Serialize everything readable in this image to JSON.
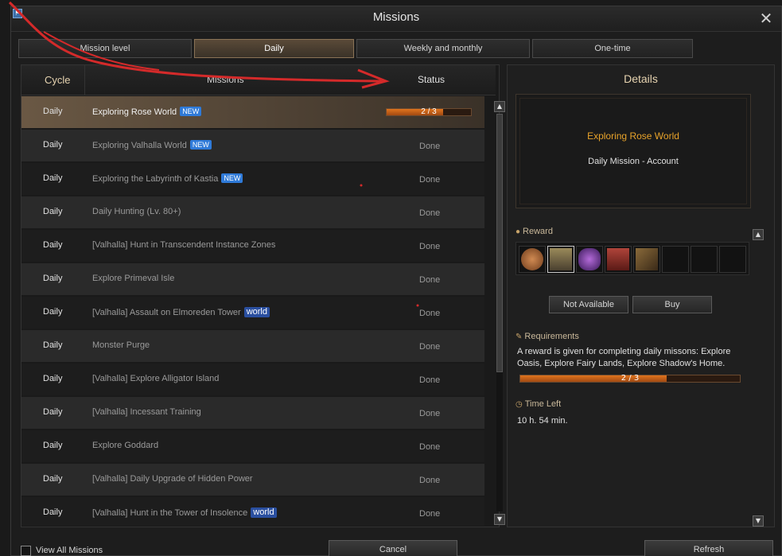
{
  "window": {
    "title": "Missions",
    "close_symbol": "✕",
    "corner_icon": "⚑"
  },
  "tabs": [
    {
      "label": "Mission level",
      "active": false
    },
    {
      "label": "Daily",
      "active": true
    },
    {
      "label": "Weekly and monthly",
      "active": false
    },
    {
      "label": "One-time",
      "active": false
    }
  ],
  "table": {
    "headers": {
      "cycle": "Cycle",
      "missions": "Missions",
      "status": "Status"
    },
    "rows": [
      {
        "cycle": "Daily",
        "name": "Exploring Rose World",
        "badge": "NEW",
        "status": "",
        "progress": "2 / 3"
      },
      {
        "cycle": "Daily",
        "name": "Exploring Valhalla World",
        "badge": "NEW",
        "status": "Done"
      },
      {
        "cycle": "Daily",
        "name": "Exploring the Labyrinth of Kastia",
        "badge": "NEW",
        "status": "Done"
      },
      {
        "cycle": "Daily",
        "name": "Daily Hunting (Lv. 80+)",
        "badge": "",
        "status": "Done"
      },
      {
        "cycle": "Daily",
        "name": "[Valhalla] Hunt in Transcendent Instance Zones",
        "badge": "",
        "status": "Done"
      },
      {
        "cycle": "Daily",
        "name": "Explore Primeval Isle",
        "badge": "",
        "status": "Done"
      },
      {
        "cycle": "Daily",
        "name": "[Valhalla] Assault on Elmoreden Tower",
        "badge": "world",
        "status": "Done"
      },
      {
        "cycle": "Daily",
        "name": "Monster Purge",
        "badge": "",
        "status": "Done"
      },
      {
        "cycle": "Daily",
        "name": "[Valhalla] Explore Alligator Island",
        "badge": "",
        "status": "Done"
      },
      {
        "cycle": "Daily",
        "name": "[Valhalla] Incessant Training",
        "badge": "",
        "status": "Done"
      },
      {
        "cycle": "Daily",
        "name": "Explore Goddard",
        "badge": "",
        "status": "Done"
      },
      {
        "cycle": "Daily",
        "name": "[Valhalla] Daily Upgrade of Hidden Power",
        "badge": "",
        "status": "Done"
      },
      {
        "cycle": "Daily",
        "name": "[Valhalla] Hunt in the Tower of Insolence",
        "badge": "world",
        "status": "Done"
      }
    ],
    "selected_progress_fraction": 0.6667,
    "scroll_up": "▲",
    "scroll_down": "▼"
  },
  "details": {
    "title": "Details",
    "mission_title": "Exploring Rose World",
    "mission_sub": "Daily Mission  -  Account",
    "reward_label": "Reward",
    "reward_icons": [
      "nut-icon",
      "chest-icon",
      "cauldron-icon",
      "totem-icon",
      "scroll-icon",
      "",
      "",
      ""
    ],
    "not_available_label": "Not Available",
    "buy_label": "Buy",
    "requirements_label": "Requirements",
    "requirements_text": "A reward is given for completing daily missons: Explore Oasis, Explore Fairy Lands, Explore Shadow's Home.",
    "req_progress": "2 / 3",
    "req_progress_fraction": 0.6667,
    "time_left_label": "Time Left",
    "time_left_value": "10 h. 54 min."
  },
  "footer": {
    "view_all_label": "View All Missions",
    "cancel_label": "Cancel",
    "refresh_label": "Refresh"
  },
  "colors": {
    "accent_orange": "#e8a32a",
    "progress_fill": "#e0741e",
    "new_badge": "#2f7ad8",
    "world_badge": "#2a4fa0",
    "annotation_red": "#d42a2a"
  }
}
